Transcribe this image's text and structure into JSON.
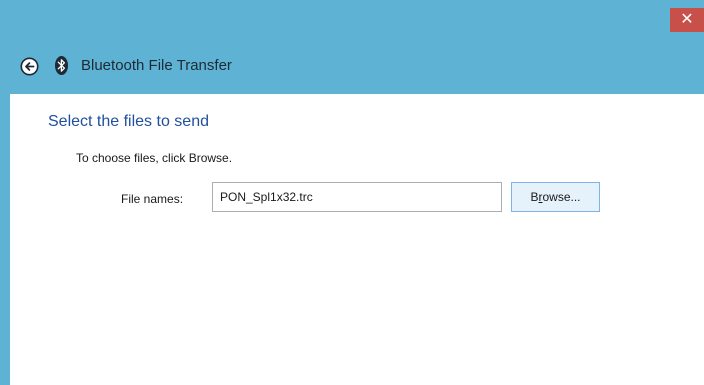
{
  "window": {
    "close_glyph": "✕",
    "accent_color": "#5eb3d4",
    "close_color": "#c7504a"
  },
  "header": {
    "back_icon": "back-arrow-icon",
    "app_icon": "bluetooth-icon",
    "title": "Bluetooth File Transfer"
  },
  "main": {
    "heading": "Select the files to send",
    "instruction": "To choose files, click Browse.",
    "file_names_label": "File names:",
    "file_names_value": "PON_Spl1x32.trc",
    "browse_button": {
      "label": "Browse...",
      "prefix": "B",
      "accesskey": "r",
      "suffix": "owse..."
    }
  }
}
